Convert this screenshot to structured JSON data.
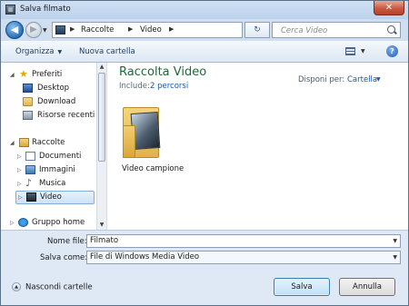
{
  "window": {
    "title": "Salva filmato",
    "close_symbol": "✕"
  },
  "address_bar": {
    "breadcrumb": [
      "Raccolte",
      "Video"
    ],
    "search_placeholder": "Cerca Video"
  },
  "toolbar": {
    "organize": "Organizza",
    "new_folder": "Nuova cartella",
    "help": "?"
  },
  "nav": {
    "favorites": {
      "label": "Preferiti",
      "items": [
        "Desktop",
        "Download",
        "Risorse recenti"
      ]
    },
    "libraries": {
      "label": "Raccolte",
      "items": [
        "Documenti",
        "Immagini",
        "Musica",
        "Video"
      ],
      "selected": "Video"
    },
    "homegroup": {
      "label": "Gruppo home"
    }
  },
  "content": {
    "library_title": "Raccolta Video",
    "include_label": "Include:",
    "include_link": "2 percorsi",
    "arrange_label": "Disponi per:",
    "arrange_value": "Cartella",
    "items": [
      {
        "name": "Video campione",
        "icon": "video-folder-icon"
      }
    ]
  },
  "fields": {
    "filename_label": "Nome file:",
    "filename_value": "Filmato",
    "savetype_label": "Salva come:",
    "savetype_value": "File di Windows Media Video"
  },
  "footer": {
    "hide_folders": "Nascondi cartelle",
    "save_button": "Salva",
    "cancel_button": "Annulla"
  }
}
